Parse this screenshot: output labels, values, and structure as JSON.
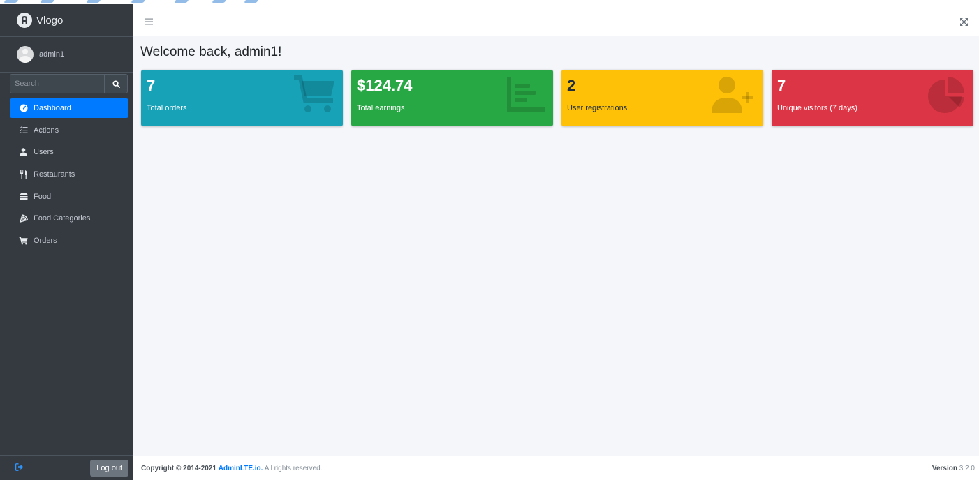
{
  "brand": {
    "name": "Vlogo"
  },
  "user": {
    "name": "admin1"
  },
  "search": {
    "placeholder": "Search"
  },
  "nav": [
    {
      "label": "Dashboard",
      "icon": "tachometer-icon",
      "active": true
    },
    {
      "label": "Actions",
      "icon": "list-check-icon"
    },
    {
      "label": "Users",
      "icon": "user-icon"
    },
    {
      "label": "Restaurants",
      "icon": "utensils-icon"
    },
    {
      "label": "Food",
      "icon": "burger-icon"
    },
    {
      "label": "Food Categories",
      "icon": "pizza-slice-icon"
    },
    {
      "label": "Orders",
      "icon": "cart-icon"
    }
  ],
  "logout": {
    "label": "Log out"
  },
  "welcome": "Welcome back, admin1!",
  "stats": [
    {
      "value": "7",
      "label": "Total orders",
      "color": "#17a2b8",
      "icon": "cart-icon"
    },
    {
      "value": "$124.74",
      "label": "Total earnings",
      "color": "#28a745",
      "icon": "bar-chart-icon"
    },
    {
      "value": "2",
      "label": "User registrations",
      "color": "#ffc107",
      "icon": "user-plus-icon"
    },
    {
      "value": "7",
      "label": "Unique visitors (7 days)",
      "color": "#dc3545",
      "icon": "pie-chart-icon"
    }
  ],
  "footer": {
    "copyright_prefix": "Copyright © 2014-2021",
    "link": "AdminLTE.io.",
    "suffix": "All rights reserved.",
    "version_label": "Version",
    "version": "3.2.0"
  }
}
